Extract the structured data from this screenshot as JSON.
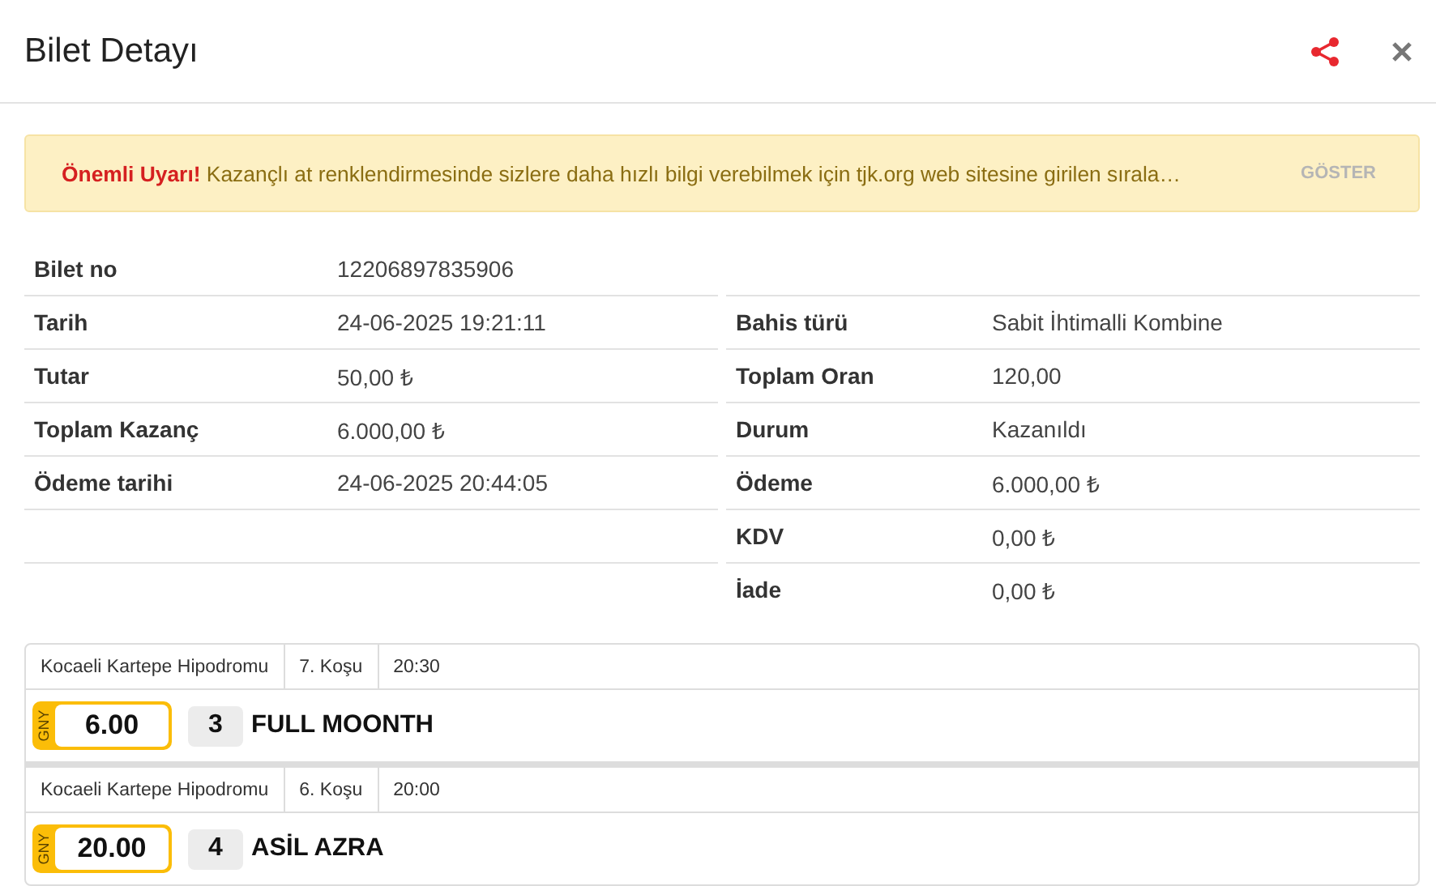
{
  "header": {
    "title": "Bilet Detayı"
  },
  "alert": {
    "prefix": "Önemli Uyarı!",
    "message": "Kazançlı at renklendirmesinde sizlere daha hızlı bilgi verebilmek için tjk.org web sitesine girilen sırala…",
    "action": "GÖSTER"
  },
  "details_left": [
    {
      "label": "Bilet no",
      "value": "12206897835906"
    },
    {
      "label": "Tarih",
      "value": "24-06-2025 19:21:11"
    },
    {
      "label": "Tutar",
      "value": "50,00 ₺"
    },
    {
      "label": "Toplam Kazanç",
      "value": "6.000,00 ₺"
    },
    {
      "label": "Ödeme tarihi",
      "value": "24-06-2025 20:44:05"
    }
  ],
  "details_right": [
    {
      "label": "Bahis türü",
      "value": "Sabit İhtimalli Kombine"
    },
    {
      "label": "Toplam Oran",
      "value": "120,00"
    },
    {
      "label": "Durum",
      "value": "Kazanıldı"
    },
    {
      "label": "Ödeme",
      "value": "6.000,00 ₺"
    },
    {
      "label": "KDV",
      "value": "0,00 ₺"
    },
    {
      "label": "İade",
      "value": "0,00 ₺"
    }
  ],
  "races": [
    {
      "venue": "Kocaeli Kartepe Hipodromu",
      "race": "7. Koşu",
      "time": "20:30",
      "bet_type": "GNY",
      "odds": "6.00",
      "horse_no": "3",
      "horse": "FULL MOONTH"
    },
    {
      "venue": "Kocaeli Kartepe Hipodromu",
      "race": "6. Koşu",
      "time": "20:00",
      "bet_type": "GNY",
      "odds": "20.00",
      "horse_no": "4",
      "horse": "ASİL AZRA"
    }
  ]
}
